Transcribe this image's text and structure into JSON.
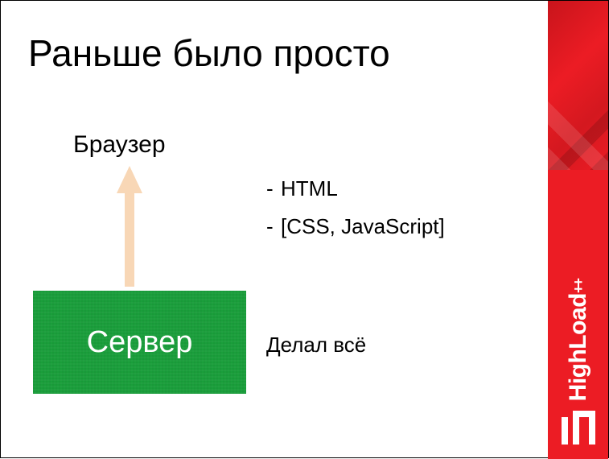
{
  "title": "Раньше было просто",
  "browser_label": "Браузер",
  "server_label": "Сервер",
  "server_caption": "Делал всё",
  "bullets": {
    "item1": "HTML",
    "item2": "[CSS, JavaScript]"
  },
  "sidebar": {
    "brand": "HighLoad",
    "suffix": "++"
  },
  "colors": {
    "accent_red": "#ec1c24",
    "server_green": "#1a9e3b",
    "arrow": "#f8d7b6"
  }
}
